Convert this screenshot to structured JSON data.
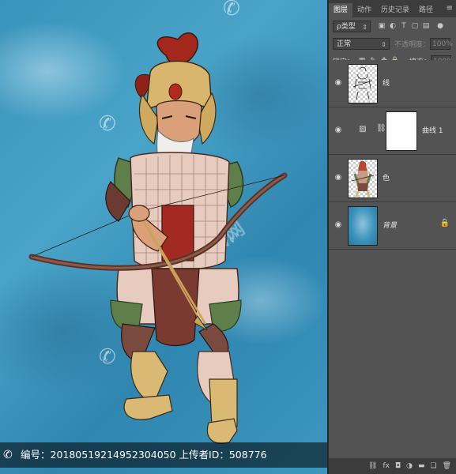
{
  "canvas": {
    "info_bar": "编号：20180519214952304050 上传者ID：508776",
    "watermark_text": "汇图网",
    "watermark_url": "www.huitu.com"
  },
  "panel": {
    "tabs": [
      {
        "label": "图层",
        "active": true
      },
      {
        "label": "动作",
        "active": false
      },
      {
        "label": "历史记录",
        "active": false
      },
      {
        "label": "路径",
        "active": false
      }
    ],
    "filter": {
      "label": "ρ类型"
    },
    "blend_mode": "正常",
    "opacity_label": "不透明度：",
    "opacity_value": "100%",
    "lock_label": "锁定：",
    "fill_label": "填充：",
    "fill_value": "100%",
    "layers": [
      {
        "name": "线",
        "type": "pixel",
        "thumb": "lineart",
        "selected": false
      },
      {
        "name": "曲线 1",
        "type": "adjustment",
        "thumb": "mask",
        "selected": false
      },
      {
        "name": "色",
        "type": "pixel",
        "thumb": "color",
        "selected": false
      },
      {
        "name": "背景",
        "type": "background",
        "thumb": "background",
        "selected": false,
        "locked": true
      }
    ]
  },
  "colors": {
    "panel_bg": "#535353",
    "tab_bar": "#3c3c3c",
    "canvas_blue": "#3a93ba"
  }
}
